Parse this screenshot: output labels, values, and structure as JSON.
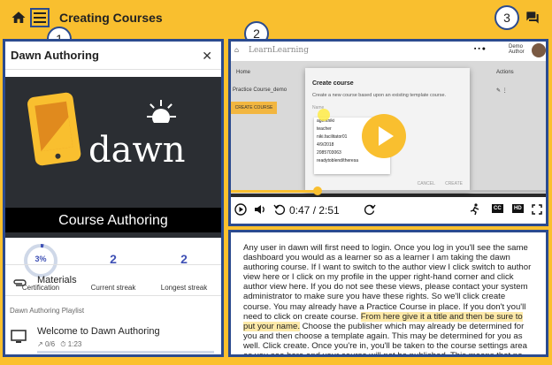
{
  "app": {
    "title": "Creating Courses"
  },
  "callouts": [
    "1",
    "2",
    "3"
  ],
  "left_panel": {
    "title": "Dawn Authoring",
    "banner": {
      "brand": "dawn",
      "course_title": "Course Authoring"
    },
    "stats": [
      {
        "value": "3%",
        "label": "Certification"
      },
      {
        "value": "2",
        "label": "Current streak"
      },
      {
        "value": "2",
        "label": "Longest streak"
      }
    ],
    "certification_progress": 0.03,
    "materials_label": "Materials",
    "playlist_heading": "Dawn Authoring Playlist",
    "lesson": {
      "title": "Welcome to Dawn Authoring",
      "progress": "0/6",
      "duration": "1:23"
    }
  },
  "video": {
    "inner_app": {
      "logo": "LearnLearning",
      "user_label": "Demo Author",
      "home_label": "Home",
      "actions_label": "Actions",
      "row_label": "Practice Course_demo",
      "create_button": "CREATE COURSE"
    },
    "modal": {
      "title": "Create course",
      "description": "Create a new course based upon an existing template course.",
      "field_label": "Name",
      "options": [
        "agentniki",
        "teacher",
        "niki.facilitator01",
        "4/9/2018",
        "2085703063",
        "readytoblend/theresa"
      ],
      "cancel": "CANCEL",
      "create": "CREATE"
    },
    "current_time": "0:47",
    "duration": "2:51",
    "time_display": "0:47 / 2:51",
    "progress_fraction": 0.275,
    "cc_label": "CC",
    "hd_label": "HD"
  },
  "transcript": {
    "before": "Any user in dawn will first need to login. Once you log in you'll see the same dashboard you would as a learner so as a learner I am taking the dawn authoring course. If I want to switch to the author view I click switch to author view here or I click on my profile in the upper right-hand corner and click author view here. If you do not see these views, please contact your system administrator to make sure you have these rights. So we'll click create course. You may already have a Practice Course in place. If you don't you'll need to click on create course.",
    "highlight": "From here give it a title and then be sure to put your name.",
    "after": "Choose the publisher which may already be determined for you and then choose a template again. This may be determined for you as well. Click create. Once you're in, you'll be taken to the course settings area as you see here and your course will not be published. This means that no user or learner can enroll in your course until you slide the publish toggle to the published position. If at any point you want to see the"
  },
  "colors": {
    "accent": "#f9bf2f",
    "annotation": "#2b4b8f",
    "link": "#3f51b5"
  }
}
